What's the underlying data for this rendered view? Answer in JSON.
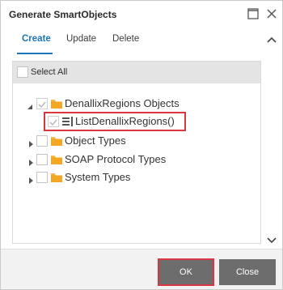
{
  "window": {
    "title": "Generate SmartObjects"
  },
  "tabs": [
    {
      "label": "Create",
      "active": true
    },
    {
      "label": "Update",
      "active": false
    },
    {
      "label": "Delete",
      "active": false
    }
  ],
  "select_all": {
    "label": "Select All",
    "checked": false
  },
  "tree": {
    "items": [
      {
        "label": "DenallixRegions Objects",
        "expanded": true,
        "checked": true,
        "icon": "folder-icon"
      },
      {
        "label": "ListDenallixRegions()",
        "checked": true,
        "icon": "list-method-icon",
        "highlighted": true
      },
      {
        "label": "Object Types",
        "expanded": false,
        "checked": false,
        "icon": "folder-icon"
      },
      {
        "label": "SOAP Protocol Types",
        "expanded": false,
        "checked": false,
        "icon": "folder-icon"
      },
      {
        "label": "System Types",
        "expanded": false,
        "checked": false,
        "icon": "folder-icon"
      }
    ]
  },
  "footer": {
    "ok_label": "OK",
    "close_label": "Close"
  },
  "colors": {
    "accent": "#1c75bc",
    "highlight": "#d9363e",
    "button": "#6d6d6d",
    "folder": "#f5a623"
  }
}
